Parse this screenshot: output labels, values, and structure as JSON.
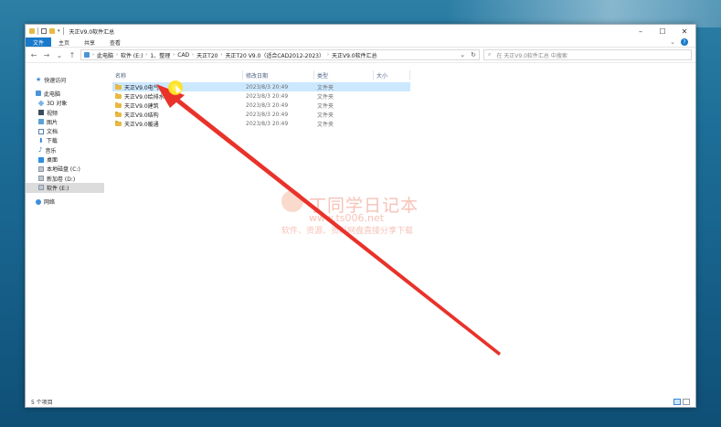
{
  "window": {
    "title": "天正V9.0软件汇总"
  },
  "ribbon": {
    "tabs": [
      "文件",
      "主页",
      "共享",
      "查看"
    ]
  },
  "address": {
    "crumbs": [
      "此电脑",
      "软件 (E:)",
      "1、整理",
      "CAD",
      "天正T20",
      "天正T20 V9.0（适合CAD2012-2023）",
      "天正V9.0软件汇总"
    ]
  },
  "search": {
    "placeholder": "在 天正V9.0软件汇总 中搜索"
  },
  "nav": {
    "quick_access": "快速访问",
    "this_pc": "此电脑",
    "objects3d": "3D 对象",
    "videos": "视频",
    "pictures": "图片",
    "documents": "文档",
    "downloads": "下载",
    "music": "音乐",
    "desktop": "桌面",
    "local_c": "本地磁盘 (C:)",
    "new_d": "新加卷 (D:)",
    "soft_e": "软件 (E:)",
    "network": "网络"
  },
  "columns": {
    "name": "名称",
    "date": "修改日期",
    "type": "类型",
    "size": "大小"
  },
  "files": [
    {
      "name": "天正V9.0电气",
      "date": "2023/8/3 20:49",
      "type": "文件夹"
    },
    {
      "name": "天正V9.0给排水",
      "date": "2023/8/3 20:49",
      "type": "文件夹"
    },
    {
      "name": "天正V9.0建筑",
      "date": "2023/8/3 20:49",
      "type": "文件夹"
    },
    {
      "name": "天正V9.0结构",
      "date": "2023/8/3 20:49",
      "type": "文件夹"
    },
    {
      "name": "天正V9.0暖通",
      "date": "2023/8/3 20:49",
      "type": "文件夹"
    }
  ],
  "status": {
    "count": "5 个项目"
  },
  "watermark": {
    "title": "丁同学日记本",
    "url": "www.ts006.net",
    "slogan": "软件、资源、资料网盘直接分享下载"
  },
  "colors": {
    "accent": "#1979ca",
    "selection": "#cce8ff",
    "arrow": "#e8322a",
    "folder": "#e8b942"
  }
}
